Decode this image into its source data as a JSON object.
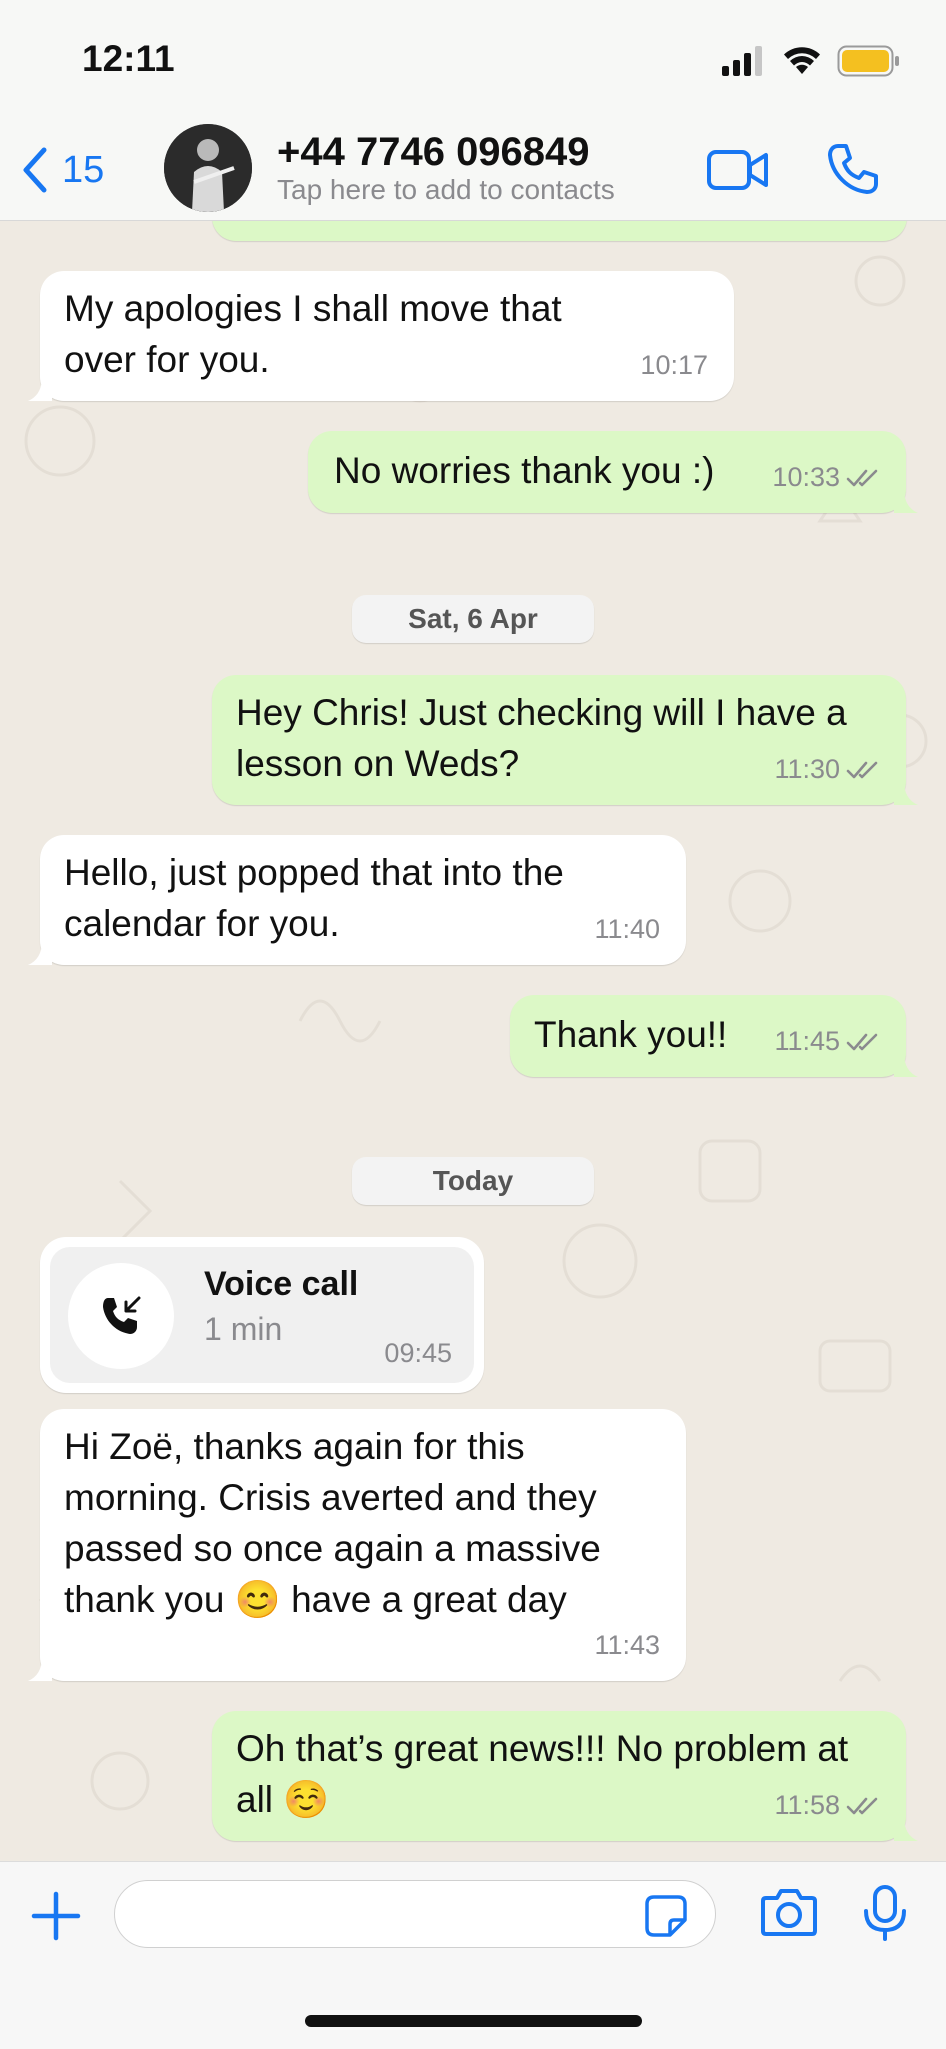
{
  "status_bar": {
    "time": "12:11",
    "icons": [
      "cellular-signal-icon",
      "wifi-icon",
      "battery-icon"
    ]
  },
  "header": {
    "back_count": "15",
    "contact_name": "+44 7746 096849",
    "subtitle": "Tap here to add to contacts",
    "accent_color": "#1877f2"
  },
  "messages": [
    {
      "dir": "in",
      "text": "My apologies I shall move that over for you.",
      "time": "10:17"
    },
    {
      "dir": "out",
      "text": "No worries thank you :)",
      "time": "10:33",
      "read": true
    },
    {
      "type": "date",
      "label": "Sat, 6 Apr"
    },
    {
      "dir": "out",
      "text": "Hey Chris! Just checking will I have a lesson on Weds?",
      "time": "11:30",
      "read": true
    },
    {
      "dir": "in",
      "text": "Hello, just popped that into the calendar for you.",
      "time": "11:40"
    },
    {
      "dir": "out",
      "text": "Thank you!!",
      "time": "11:45",
      "read": true
    },
    {
      "type": "date",
      "label": "Today"
    },
    {
      "type": "call",
      "title": "Voice call",
      "duration": "1 min",
      "time": "09:45"
    },
    {
      "dir": "in",
      "text": "Hi Zoë, thanks again for this morning. Crisis averted and they passed so once again a massive thank you 😊 have a great day",
      "time": "11:43"
    },
    {
      "dir": "out",
      "text": "Oh that’s great news!!! No problem at all ☺️",
      "time": "11:58",
      "read": true
    }
  ],
  "input": {
    "placeholder": ""
  },
  "colors": {
    "incoming_bubble": "#ffffff",
    "outgoing_bubble": "#dcf8c6",
    "wallpaper": "#efeae2"
  }
}
